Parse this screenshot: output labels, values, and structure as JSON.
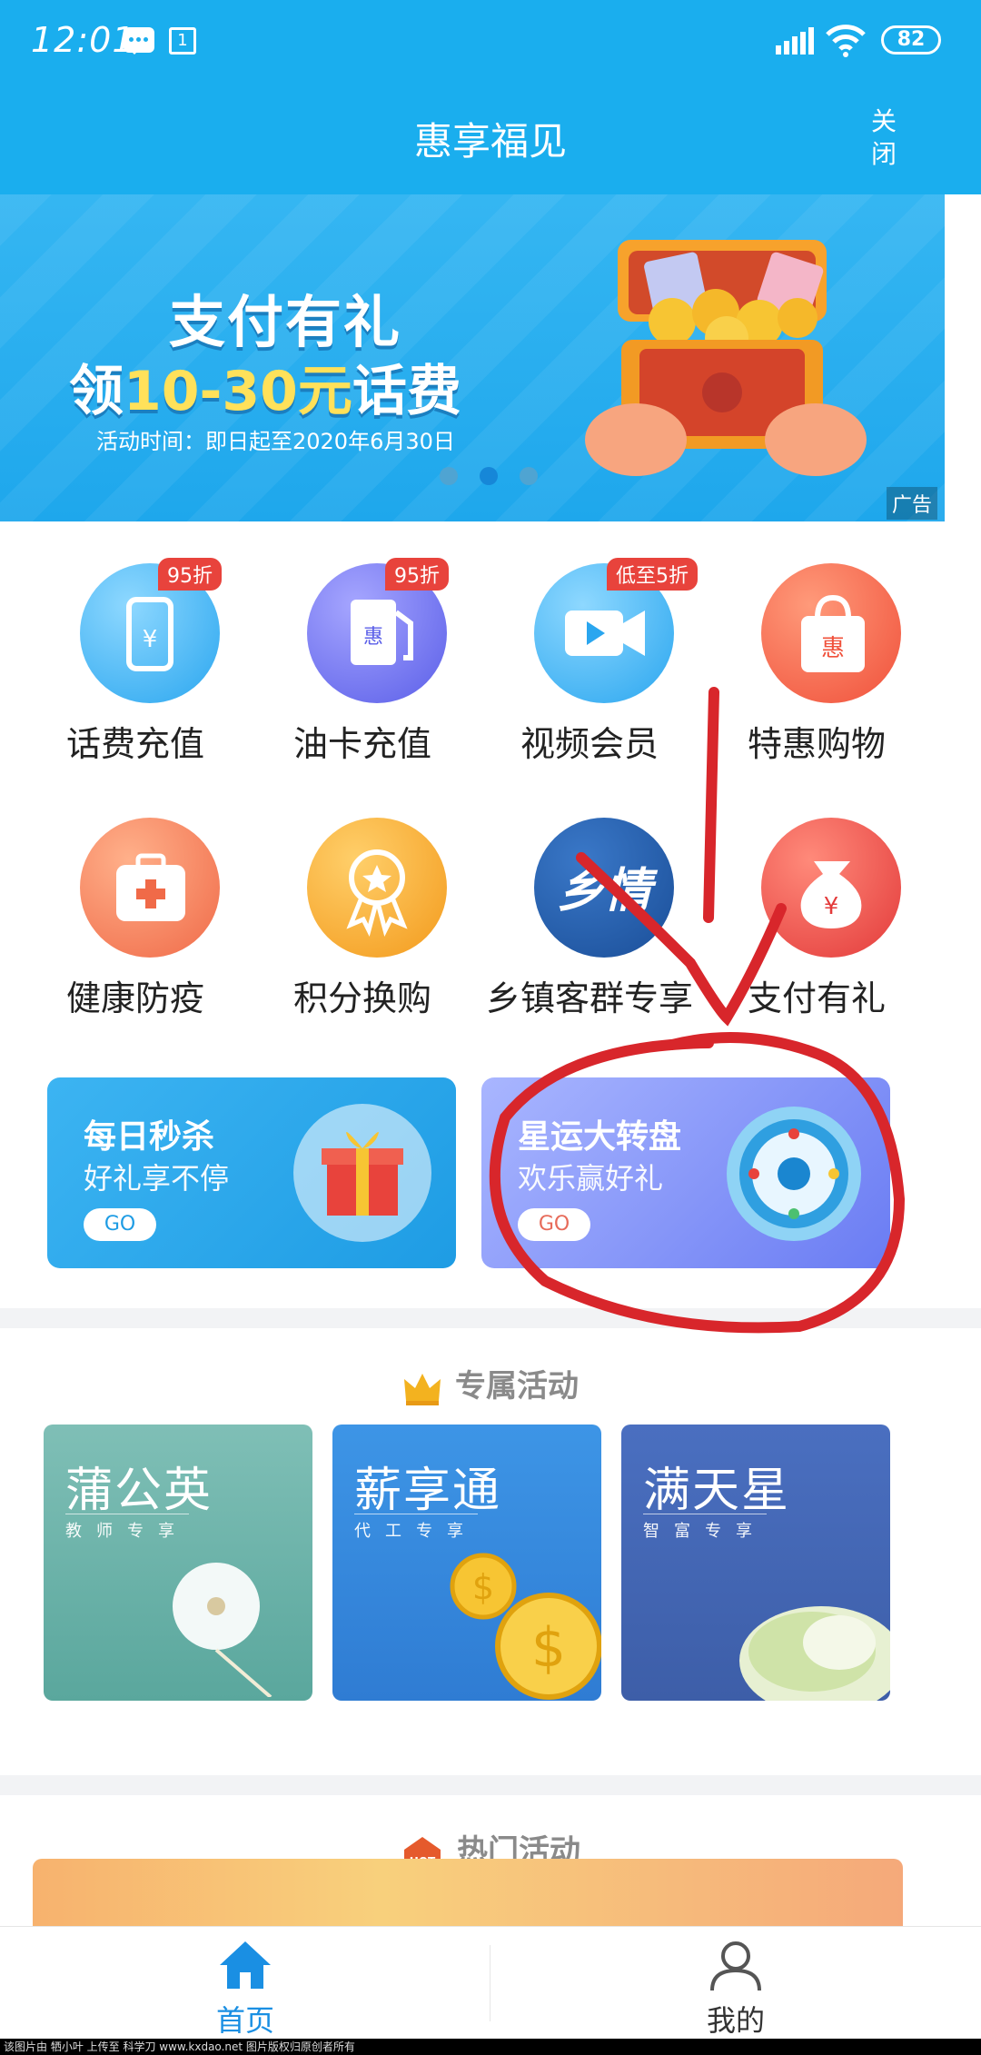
{
  "status_bar": {
    "time": "12:01",
    "sim_label": "1",
    "battery": "82"
  },
  "header": {
    "title": "惠享福见",
    "close_label": "关闭"
  },
  "banner": {
    "title": "支付有礼",
    "subtitle_pre": "领",
    "subtitle_highlight": "10-30元",
    "subtitle_post": "话费",
    "date": "活动时间：即日起至2020年6月30日",
    "ad_tag": "广告",
    "active_slide_index": 1,
    "slide_count": 3
  },
  "grid": [
    {
      "label": "话费充值",
      "badge": "95折",
      "icon": "phone-yuan-icon"
    },
    {
      "label": "油卡充值",
      "badge": "95折",
      "icon": "fuel-pump-icon"
    },
    {
      "label": "视频会员",
      "badge": "低至5折",
      "icon": "video-camera-icon"
    },
    {
      "label": "特惠购物",
      "badge": "",
      "icon": "shopping-bag-icon"
    },
    {
      "label": "健康防疫",
      "badge": "",
      "icon": "medical-kit-icon"
    },
    {
      "label": "积分换购",
      "badge": "",
      "icon": "award-medal-icon"
    },
    {
      "label": "乡镇客群专享",
      "badge": "",
      "icon": "xiangqing-logo-icon"
    },
    {
      "label": "支付有礼",
      "badge": "",
      "icon": "money-bag-icon"
    }
  ],
  "promos": [
    {
      "title": "每日秒杀",
      "subtitle": "好礼享不停",
      "go": "GO",
      "color": "#2aa8ec"
    },
    {
      "title": "星运大转盘",
      "subtitle": "欢乐赢好礼",
      "go": "GO",
      "color": "#7a8cf5"
    }
  ],
  "exclusive": {
    "title": "专属活动",
    "cards": [
      {
        "title": "蒲公英",
        "subtitle": "教师专享",
        "color": "#6fb6ad"
      },
      {
        "title": "薪享通",
        "subtitle": "代工专享",
        "color": "#3c8ce0"
      },
      {
        "title": "满天星",
        "subtitle": "智富专享",
        "color": "#4268b8"
      }
    ]
  },
  "hot": {
    "title": "热门活动",
    "badge": "HOT"
  },
  "bottom_nav": [
    {
      "label": "首页",
      "active": true
    },
    {
      "label": "我的",
      "active": false
    }
  ],
  "watermark": "该图片由 牺小叶 上传至 科学刀 www.kxdao.net 图片版权归原创者所有",
  "colors": {
    "primary": "#1aaeee",
    "accent_red": "#e8433c",
    "annotation": "#d8262b"
  }
}
